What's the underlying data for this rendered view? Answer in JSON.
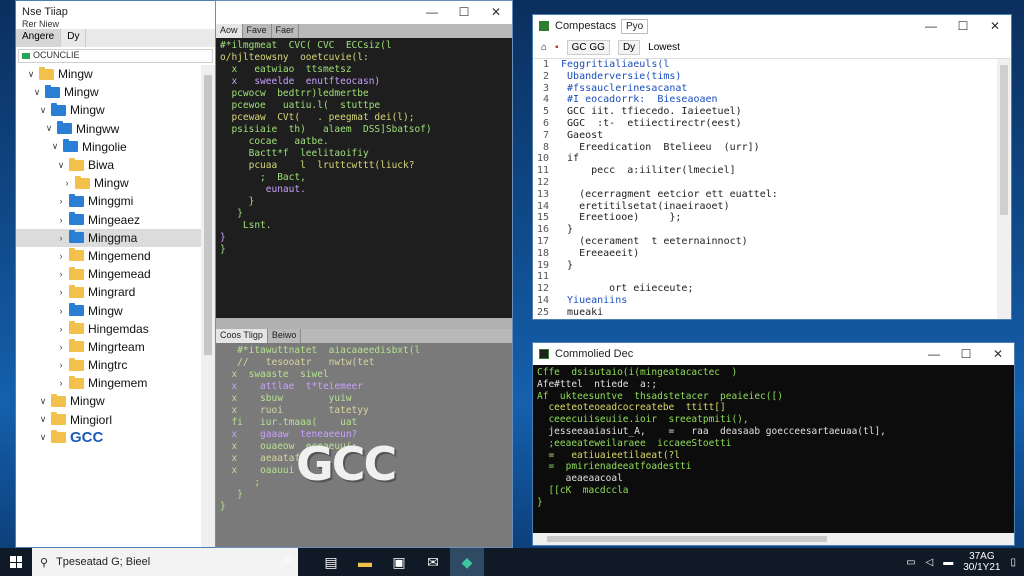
{
  "explorer": {
    "title": "Nse Tiiap",
    "menu": "Rer Niew",
    "tabs": [
      "Angere",
      "Dy"
    ],
    "address": "OCUNCLIE",
    "tree": [
      {
        "label": "Mingw",
        "caret": "∨",
        "icon": "y"
      },
      {
        "label": "Mingw",
        "caret": "∨",
        "icon": "b"
      },
      {
        "label": "Mingw",
        "caret": "∨",
        "icon": "b"
      },
      {
        "label": "Mingww",
        "caret": "∨",
        "icon": "b"
      },
      {
        "label": "Mingolie",
        "caret": "∨",
        "icon": "b"
      },
      {
        "label": "Biwa",
        "caret": "∨",
        "icon": "y"
      },
      {
        "label": "Mingw",
        "caret": "›",
        "icon": "y"
      },
      {
        "label": "Minggmi",
        "caret": "›",
        "icon": "b"
      },
      {
        "label": "Mingeaez",
        "caret": "›",
        "icon": "b"
      },
      {
        "label": "Minggma",
        "caret": "›",
        "icon": "b"
      },
      {
        "label": "Mingemend",
        "caret": "›",
        "icon": "y"
      },
      {
        "label": "Mingemead",
        "caret": "›",
        "icon": "y"
      },
      {
        "label": "Mingrard",
        "caret": "›",
        "icon": "y"
      },
      {
        "label": "Mingw",
        "caret": "›",
        "icon": "b"
      },
      {
        "label": "Hingemdas",
        "caret": "›",
        "icon": "y"
      },
      {
        "label": "Mingrteam",
        "caret": "›",
        "icon": "y"
      },
      {
        "label": "Mingtrc",
        "caret": "›",
        "icon": "y"
      },
      {
        "label": "Mingemem",
        "caret": "›",
        "icon": "y"
      },
      {
        "label": "Mingw",
        "caret": "∨",
        "icon": "y"
      },
      {
        "label": "Mingiorl",
        "caret": "∨",
        "icon": "y"
      },
      {
        "label": "GCC",
        "caret": "∨",
        "icon": "y"
      }
    ]
  },
  "editor": {
    "top_tabs": [
      "Aow",
      "Fave",
      "Faer"
    ],
    "bottom_tabs": [
      "Coos Tligp",
      "Beiwo"
    ],
    "top_code": [
      "#*ilmgmeat  CVC( CVC  ECCsiz(l",
      "o/hjlteowsny  ooetcuvie(l:",
      "  x   eatwiao  ttsmetsz",
      "  x   sweelde  enutfteocasn)",
      "  pcwocw  bedtrr)ledmertbe",
      "  pcewoe   uatiu.l(  stuttpe",
      "  pcewaw  CVt(   . peegmat dei(l);",
      "  psisiaie  th)   alaem  DSS]Sbatsof)",
      "",
      "     cocae   aatbe.",
      "     Bactt*f  leelitaoifiy",
      "     pcuaa    l  lruttcwttt(liuck?",
      "       ;  Bact,",
      "        eunaut.",
      "     }",
      "   }",
      "",
      "    Lsnt.",
      "}",
      "",
      "}"
    ],
    "bottom_code": [
      "   #*itawuttnatet  aiacaaeedisbxt(l",
      "   //   tesooatr   nwtw(tet",
      "  x  swaaste  siwel",
      "  x    attlae  t*teiemeer",
      "  x    sbuw        yuiw",
      "  x    ruoi        tatetyy",
      "  fi   iur.tmaaa(    uat",
      "  x    gaaaw  teneaeeun?",
      "  x    ouaeow  eceaeuu(;",
      "  x    aeaatafw",
      "  x    oaauui",
      "",
      "      ;",
      "",
      "   }",
      "",
      "}"
    ],
    "logo_text": "GCC"
  },
  "ide": {
    "title": "Compestacs",
    "title_tab": "Pyo",
    "toolbar": [
      "GC GG",
      "Dy",
      "Lowest"
    ],
    "lines": [
      {
        "n": "1",
        "t": " Feggritialiaeuls(l",
        "blue": true
      },
      {
        "n": "2",
        "t": "  Ubanderversie(tims)",
        "blue": true
      },
      {
        "n": "3",
        "t": "  #fssauclerinesacanat",
        "blue": true
      },
      {
        "n": "4",
        "t": "  #I eocadorrk:  Bieseaoaen",
        "blue": true
      },
      {
        "n": "5",
        "t": "  GCC iit. tfiecedo. Iaieetuel)",
        "blue": false
      },
      {
        "n": "6",
        "t": "  GGC  :t-  etiiectirectr(eest)",
        "blue": false
      },
      {
        "n": "7",
        "t": "  Gaeost",
        "blue": false
      },
      {
        "n": "8",
        "t": "    Ereedication  Btelieeu  (urr])",
        "blue": false
      },
      {
        "n": "10",
        "t": "  if",
        "blue": false
      },
      {
        "n": "11",
        "t": "      pecc  a:iiliter(lmeciel]",
        "blue": false
      },
      {
        "n": "12",
        "t": "",
        "blue": false
      },
      {
        "n": "13",
        "t": "    (ecerragment eetcior ett euattel:",
        "blue": false
      },
      {
        "n": "14",
        "t": "    eretitilsetat(inaeiraoet)",
        "blue": false
      },
      {
        "n": "15",
        "t": "    Ereetiooe)     };",
        "blue": false
      },
      {
        "n": "16",
        "t": "  }",
        "blue": false
      },
      {
        "n": "17",
        "t": "    (ecerament  t eeternainnoct)",
        "blue": false
      },
      {
        "n": "18",
        "t": "    Ereeaeeit)",
        "blue": false
      },
      {
        "n": "19",
        "t": "  }",
        "blue": false
      },
      {
        "n": "11",
        "t": "",
        "blue": false
      },
      {
        "n": "12",
        "t": "         ort eiieceute;",
        "blue": false
      },
      {
        "n": "14",
        "t": "  Yiueaniins",
        "blue": true
      },
      {
        "n": "25",
        "t": "  mueaki",
        "blue": false
      }
    ]
  },
  "cmd": {
    "title": "Commolied Dec",
    "lines": [
      "Cffe  dsisutaio(i(mingeatacactec  )",
      "Afe#ttel  ntiede  a:;",
      "Af  ukteesuntve  thsadstetacer  peaieiec([)",
      "  ceeteoteoeadcocreatebe  ttitt[]",
      "  ceeecuiiseuiie.ioir  sreeatpmiti(),",
      "  jesseeaaiasiut_A,    =   raa  deasaab goecceesartaeuaa(tl],",
      "  ;eeaeateweilaraee  iccaeeStoetti",
      "  =   eatiuaieetilaeat(?l",
      "  =  pmirienadeeatfoadestti",
      "     aeaeaacoal",
      "  [[cK  macdccla",
      "",
      "}"
    ]
  },
  "taskbar": {
    "search_text": "Tpeseatad  G;  Bieel",
    "time": "37AG",
    "date": "30/1Y21"
  }
}
